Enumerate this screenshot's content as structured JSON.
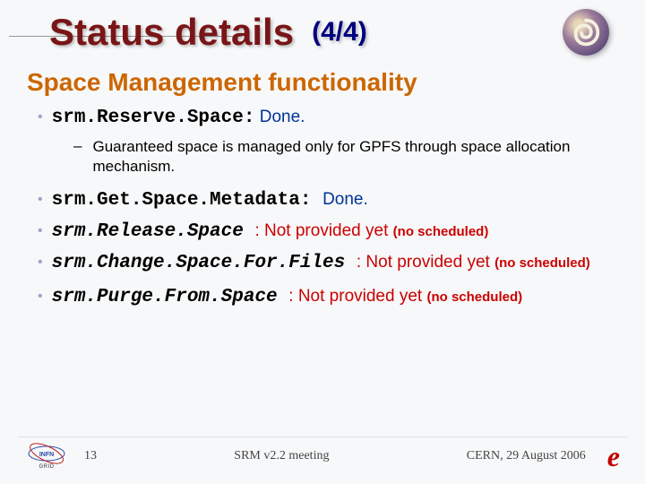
{
  "title": {
    "main": "Status details",
    "page": "(4/4)"
  },
  "subtitle": "Space Management functionality",
  "items": [
    {
      "api": "srm.Reserve.Space:",
      "status": " Done.",
      "status_class": "done",
      "note": "",
      "api_style": "mono-bold",
      "sub": "Guaranteed space is managed only for GPFS through space allocation mechanism."
    },
    {
      "api": "srm.Get.Space.Metadata: ",
      "status": " Done.",
      "status_class": "done",
      "note": "",
      "api_style": "mono-bold"
    },
    {
      "api": "srm.Release.Space ",
      "status": ": Not provided yet ",
      "status_class": "notprov",
      "note": "(no scheduled)",
      "api_style": "mono-bold-italic"
    },
    {
      "api": "srm.Change.Space.For.Files ",
      "status": ": Not provided yet ",
      "status_class": "notprov",
      "note": "(no scheduled)",
      "api_style": "mono-bold-italic"
    },
    {
      "api": "srm.Purge.From.Space ",
      "status": ": Not provided yet ",
      "status_class": "notprov",
      "note": "(no scheduled)",
      "api_style": "mono-bold-italic"
    }
  ],
  "footer": {
    "page_num": "13",
    "center": "SRM v2.2 meeting",
    "right": "CERN, 29 August 2006",
    "logo1_label": "GRID"
  }
}
